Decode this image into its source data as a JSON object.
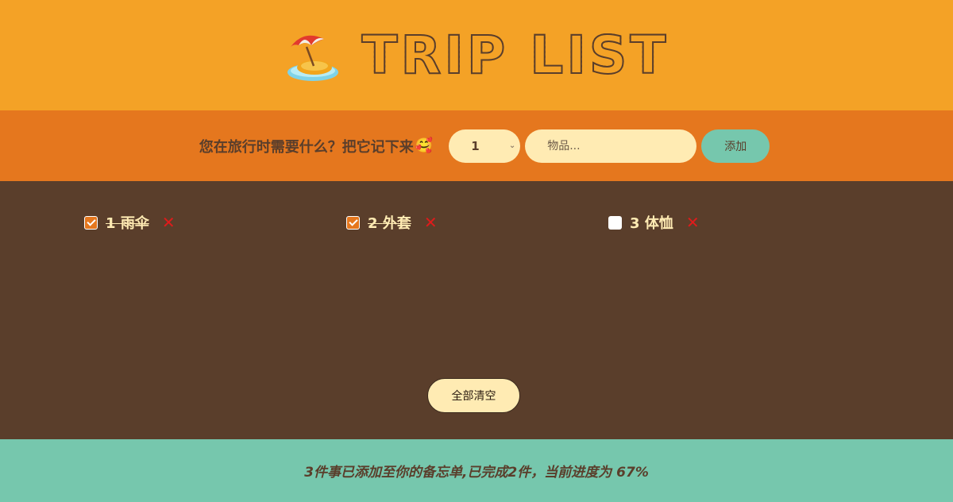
{
  "header": {
    "title": "TRIP LIST",
    "logo_icon": "beach-umbrella-island-icon"
  },
  "form": {
    "prompt": "您在旅行时需要什么？把它记下来",
    "prompt_emoji": "🥰",
    "quantity_value": "1",
    "item_placeholder": "物品...",
    "add_label": "添加"
  },
  "items": [
    {
      "quantity": "1",
      "description": "雨伞",
      "packed": true
    },
    {
      "quantity": "2",
      "description": "外套",
      "packed": true
    },
    {
      "quantity": "3",
      "description": "体恤",
      "packed": false
    }
  ],
  "clear_label": "全部清空",
  "stats": "3件事已添加至你的备忘单,已完成2件，当前进度为 67%",
  "colors": {
    "header_bg": "#f4a226",
    "form_bg": "#e5771e",
    "list_bg": "#5a3e2b",
    "footer_bg": "#76c7ad",
    "input_bg": "#ffebb3",
    "delete_red": "#e01b1b"
  }
}
